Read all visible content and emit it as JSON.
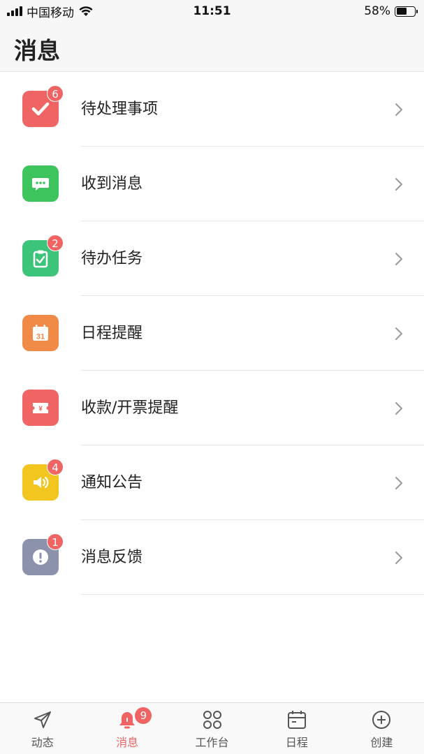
{
  "status_bar": {
    "carrier": "中国移动",
    "time": "11:51",
    "battery": "58%",
    "battery_level": 0.58
  },
  "header": {
    "title": "消息"
  },
  "colors": {
    "badge": "#f06464",
    "active_tab": "#f06464",
    "tile_todo": "#f06464",
    "tile_message": "#3dc45c",
    "tile_task": "#3cc47a",
    "tile_schedule": "#f08a46",
    "tile_payment": "#f06464",
    "tile_notice": "#f2c51f",
    "tile_feedback": "#8d92ac"
  },
  "list": {
    "items": [
      {
        "label": "待处理事项",
        "badge": "6",
        "icon": "check-icon",
        "color": "#f06464"
      },
      {
        "label": "收到消息",
        "badge": "",
        "icon": "chat-bubble-icon",
        "color": "#3dc45c"
      },
      {
        "label": "待办任务",
        "badge": "2",
        "icon": "clipboard-check-icon",
        "color": "#3cc47a"
      },
      {
        "label": "日程提醒",
        "badge": "",
        "icon": "calendar-31-icon",
        "color": "#f08a46"
      },
      {
        "label": "收款/开票提醒",
        "badge": "",
        "icon": "yen-ticket-icon",
        "color": "#f06464"
      },
      {
        "label": "通知公告",
        "badge": "4",
        "icon": "speaker-icon",
        "color": "#f2c51f"
      },
      {
        "label": "消息反馈",
        "badge": "1",
        "icon": "exclamation-icon",
        "color": "#8d92ac"
      }
    ]
  },
  "tab_bar": {
    "tabs": [
      {
        "label": "动态",
        "icon": "send-icon",
        "active": false
      },
      {
        "label": "消息",
        "icon": "bell-icon",
        "active": true,
        "badge": "9"
      },
      {
        "label": "工作台",
        "icon": "grid-icon",
        "active": false
      },
      {
        "label": "日程",
        "icon": "calendar-icon",
        "active": false
      },
      {
        "label": "创建",
        "icon": "plus-circle-icon",
        "active": false
      }
    ]
  }
}
